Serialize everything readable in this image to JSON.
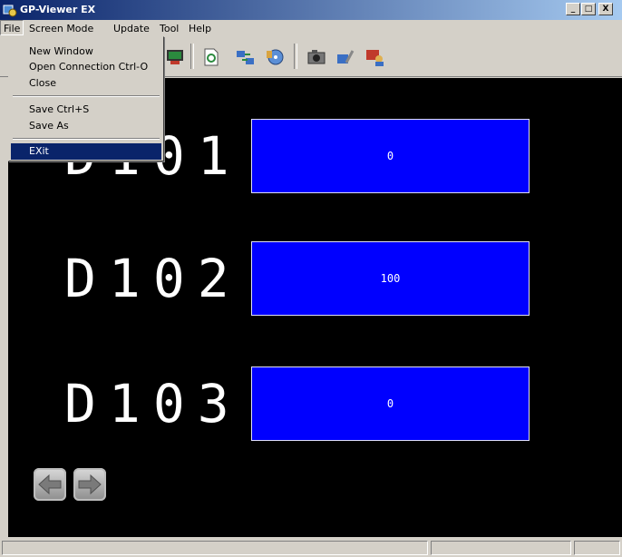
{
  "window": {
    "title": "GP-Viewer EX",
    "min": "_",
    "max": "□",
    "close": "X"
  },
  "menubar": [
    "File",
    "Screen Mode",
    "Update",
    "Tool",
    "Help"
  ],
  "file_menu": {
    "new_window": "New Window",
    "open_connection": "Open Connection  Ctrl-O",
    "close": "Close",
    "save": "Save     Ctrl+S",
    "save_as": "Save As",
    "exit": "EXit"
  },
  "toolbar_icons": [
    "monitor-icon",
    "page-refresh-icon",
    "network-transfer-icon",
    "cd-icon",
    "camera-icon",
    "settings-wrench-icon",
    "id-user-icon"
  ],
  "screen": {
    "rows": [
      {
        "label": "D101",
        "value": "0"
      },
      {
        "label": "D102",
        "value": "100"
      },
      {
        "label": "D103",
        "value": "0"
      }
    ],
    "nav": {
      "back": "arrow-left-icon",
      "forward": "arrow-right-icon"
    }
  }
}
